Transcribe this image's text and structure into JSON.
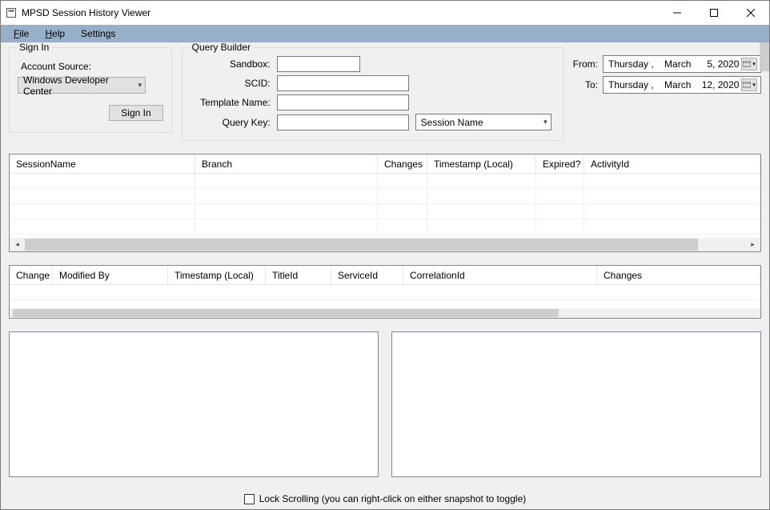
{
  "titlebar": {
    "title": "MPSD Session History Viewer"
  },
  "menu": {
    "file": "File",
    "help": "Help",
    "settings": "Settings"
  },
  "signin": {
    "legend": "Sign In",
    "account_source_label": "Account Source:",
    "account_source_value": "Windows Developer Center",
    "button": "Sign In"
  },
  "querybuilder": {
    "legend": "Query Builder",
    "sandbox_label": "Sandbox:",
    "sandbox_value": "",
    "scid_label": "SCID:",
    "scid_value": "",
    "template_label": "Template Name:",
    "template_value": "",
    "querykey_label": "Query Key:",
    "querykey_value": "",
    "querykey_type": "Session Name"
  },
  "dates": {
    "from_label": "From:",
    "from_value": "Thursday ,    March      5, 2020",
    "to_label": "To:",
    "to_value": "Thursday ,    March    12, 2020"
  },
  "grid1": {
    "columns": [
      "SessionName",
      "Branch",
      "Changes",
      "Timestamp (Local)",
      "Expired?",
      "ActivityId"
    ]
  },
  "grid2": {
    "columns": [
      "Change",
      "Modified By",
      "Timestamp (Local)",
      "TitleId",
      "ServiceId",
      "CorrelationId",
      "Changes"
    ]
  },
  "footer": {
    "lock_label": "Lock Scrolling (you can right-click on either snapshot to toggle)"
  }
}
